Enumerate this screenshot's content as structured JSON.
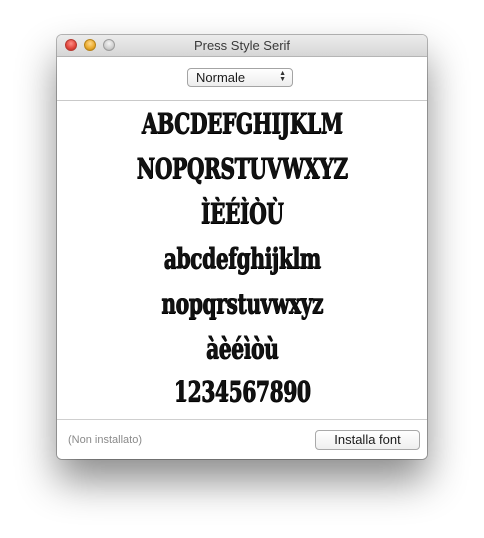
{
  "window": {
    "title": "Press Style Serif"
  },
  "toolbar": {
    "style_select": "Normale"
  },
  "preview": {
    "lines": [
      "ABCDEFGHIJKLM",
      "NOPQRSTUVWXYZ",
      "ÌÈÉÌÒÙ",
      "abcdefghijklm",
      "nopqrstuvwxyz",
      "àèéìòù",
      "1234567890"
    ]
  },
  "footer": {
    "status": "(Non installato)",
    "install_label": "Installa font"
  }
}
